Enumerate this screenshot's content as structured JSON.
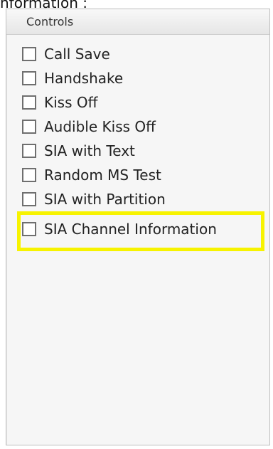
{
  "top_text": "nformation :",
  "panel": {
    "title": "Controls",
    "items": [
      {
        "label": "Call Save"
      },
      {
        "label": "Handshake"
      },
      {
        "label": "Kiss Off"
      },
      {
        "label": "Audible Kiss Off"
      },
      {
        "label": "SIA with Text"
      },
      {
        "label": "Random MS Test"
      },
      {
        "label": "SIA with Partition"
      },
      {
        "label": "SIA Channel Information"
      }
    ]
  },
  "colors": {
    "highlight": "#f7f300"
  }
}
